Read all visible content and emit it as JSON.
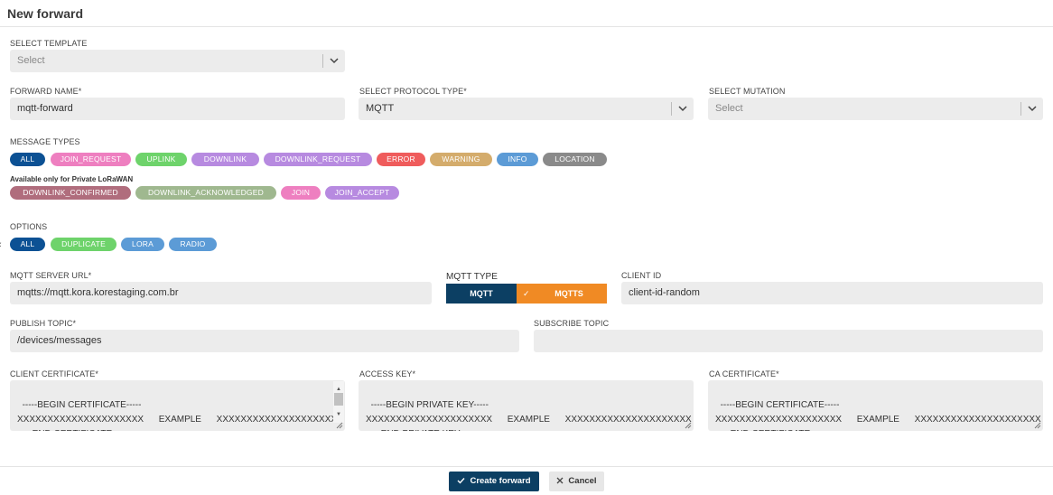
{
  "window": {
    "title": "New forward"
  },
  "template": {
    "label": "SELECT TEMPLATE",
    "placeholder": "Select"
  },
  "forward_name": {
    "label": "FORWARD NAME*",
    "value": "mqtt-forward"
  },
  "protocol": {
    "label": "SELECT PROTOCOL TYPE*",
    "value": "MQTT"
  },
  "mutation": {
    "label": "SELECT MUTATION",
    "placeholder": "Select"
  },
  "message_types": {
    "label": "MESSAGE TYPES",
    "items": [
      {
        "label": "ALL",
        "color": "#0c5194"
      },
      {
        "label": "JOIN_REQUEST",
        "color": "#ee7fc0"
      },
      {
        "label": "UPLINK",
        "color": "#6ed36b"
      },
      {
        "label": "DOWNLINK",
        "color": "#b78ae0"
      },
      {
        "label": "DOWNLINK_REQUEST",
        "color": "#b78ae0"
      },
      {
        "label": "ERROR",
        "color": "#ef5c5c"
      },
      {
        "label": "WARNING",
        "color": "#d4ac6c"
      },
      {
        "label": "INFO",
        "color": "#5c9bd6"
      },
      {
        "label": "LOCATION",
        "color": "#8a8a8a"
      }
    ],
    "private_note": "Available only for Private LoRaWAN",
    "private_items": [
      {
        "label": "DOWNLINK_CONFIRMED",
        "color": "#b06d7d"
      },
      {
        "label": "DOWNLINK_ACKNOWLEDGED",
        "color": "#9fb88f"
      },
      {
        "label": "JOIN",
        "color": "#ee7fc0"
      },
      {
        "label": "JOIN_ACCEPT",
        "color": "#b78ae0"
      }
    ]
  },
  "options": {
    "label": "OPTIONS",
    "items": [
      {
        "label": "ALL",
        "color": "#0c5194"
      },
      {
        "label": "DUPLICATE",
        "color": "#6ed36b"
      },
      {
        "label": "LORA",
        "color": "#5c9bd6"
      },
      {
        "label": "RADIO",
        "color": "#5c9bd6"
      }
    ]
  },
  "mqtt_server": {
    "label": "MQTT SERVER URL*",
    "value": "mqtts://mqtt.kora.korestaging.com.br"
  },
  "mqtt_type": {
    "label": "MQTT TYPE",
    "options": [
      {
        "label": "MQTT",
        "color": "#0c3f63"
      },
      {
        "label": "MQTTS",
        "color": "#f08a24",
        "selected": true,
        "check": "✓"
      }
    ]
  },
  "client_id": {
    "label": "CLIENT ID",
    "value": "client-id-random"
  },
  "publish_topic": {
    "label": "PUBLISH TOPIC*",
    "value": "/devices/messages"
  },
  "subscribe_topic": {
    "label": "SUBSCRIBE TOPIC",
    "value": ""
  },
  "client_certificate": {
    "label": "CLIENT CERTIFICATE*",
    "value": "-----BEGIN CERTIFICATE-----\nXXXXXXXXXXXXXXXXXXXXX      EXAMPLE      XXXXXXXXXXXXXXXXXXXXX\n-----END CERTIFICATE-----"
  },
  "access_key": {
    "label": "ACCESS KEY*",
    "value": "-----BEGIN PRIVATE KEY-----\nXXXXXXXXXXXXXXXXXXXXX      EXAMPLE      XXXXXXXXXXXXXXXXXXXXX\n-----END PRIVATE KEY-----"
  },
  "ca_certificate": {
    "label": "CA CERTIFICATE*",
    "value": "-----BEGIN CERTIFICATE-----\nXXXXXXXXXXXXXXXXXXXXX      EXAMPLE      XXXXXXXXXXXXXXXXXXXXX\n-----END CERTIFICATE-----"
  },
  "footer": {
    "create_label": "Create forward",
    "cancel_label": "Cancel"
  }
}
